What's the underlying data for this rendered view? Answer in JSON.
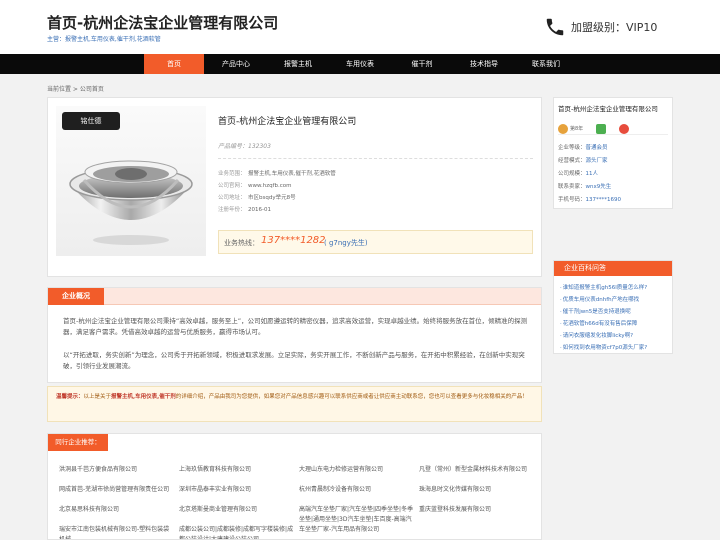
{
  "header": {
    "title": "首页-杭州企法宝企业管理有限公司",
    "subtitle": "主营：报警主机,车用仪表,催干剂,花酒软管",
    "level_label": "加盟级别：VIP10"
  },
  "nav": [
    "首页",
    "产品中心",
    "报警主机",
    "车用仪表",
    "催干剂",
    "技术指导",
    "联系我们"
  ],
  "breadcrumb": "当前位置 > 公司首页",
  "product": {
    "brand_text": "铭仕德",
    "title": "首页-杭州企法宝企业管理有限公司",
    "number": "产品编号：132303",
    "rows": [
      {
        "k": "业务范围：",
        "v": "报警主机,车用仪表,催干剂,花酒软管"
      },
      {
        "k": "公司官网：",
        "v": "www.hzqfb.com"
      },
      {
        "k": "公司地址：",
        "v": "市区bsqdy举元8号"
      },
      {
        "k": "注册年份：",
        "v": "2016-01"
      }
    ],
    "hotline_label": "业务热线：",
    "hotline_number": "137****1282",
    "hotline_contact": "( g7ngy先生)"
  },
  "sidecard": {
    "title": "首页-杭州企法宝企业管理有限公司",
    "years": "第8年",
    "rows": [
      {
        "k": "企业等级：",
        "v": "普通会员"
      },
      {
        "k": "经营模式：",
        "v": "源头厂家"
      },
      {
        "k": "公司规模：",
        "v": "11人"
      },
      {
        "k": "联系卖家：",
        "v": "wnx9先生"
      },
      {
        "k": "手机号码：",
        "v": "137****1690"
      }
    ]
  },
  "questions": {
    "title": "企业百科问答",
    "items": [
      "谁知道报警主机gh56l质量怎么样?",
      "优质车用仪表dnhfh产地在哪找",
      "催干剂jwn5是否支持退换呢",
      "花酒软管h66d有没有售后保障",
      "请问衣服缩发化妆脚licky啊?",
      "如何找到衣用物资cf7p0源头厂家?"
    ]
  },
  "overview": {
    "tab": "企业概况",
    "p1": "首页-杭州企法宝企业管理有限公司秉持“高效卓越，服务至上”，公司如愿遵运转的精密仪器，追求高效运营，实现卓越业绩。始终将服务放在首位，倾精准的探测器，满足客户需求。凭借高效卓越的运营与优质服务，赢得市场认可。",
    "p2": "以“开拓进取，务实创新”为理念，公司秀于开拓新领域，积极进取求发展。立足实际，务实开展工作，不断创新产品与服务，在开拓中积累经验，在创新中实现突破，引领行业发展潮流。"
  },
  "tip": {
    "label": "温馨提示：",
    "pre": "以上是关于",
    "products": "报警主机,车用仪表,催干剂",
    "post": "的详细介绍，产品由我司为您提供，如果您对产品信息感兴趣可以联系供应商或者让供应商主动联系您，您也可以查看更多与化妆稳相关的产品！"
  },
  "peers": {
    "title": "同行企业推荐：",
    "items": [
      "洪洞县千芭方便食品有限公司",
      "上海玖悟教育科技有限公司",
      "大理山东电力检修运营有限公司",
      "凡登（常州）新型金属材料技术有限公司",
      "网成首芭-芜湖市徐尚营管理有限责任公司",
      "深圳市晶泰丰实业有限公司",
      "杭州青晨制冷设备有限公司",
      "珠海息时文化传媒有限公司",
      "北京易思科技有限公司",
      "北京塔斯曼商业管理有限公司",
      "高端汽车坐垫厂家|汽车坐垫|四季坐垫|冬季坐垫|通用坐垫|3D汽车坐垫|车百度-高端汽车坐垫厂家-汽车用品有限公司",
      "重庆蓝登科技发展有限公司",
      "瑞安市江南包装机械有限公司-塑料包装袋机械",
      "成都公装公司|成都装修|成都写字楼装修|成都公装设计|大唐建设公装公司",
      "",
      ""
    ]
  }
}
